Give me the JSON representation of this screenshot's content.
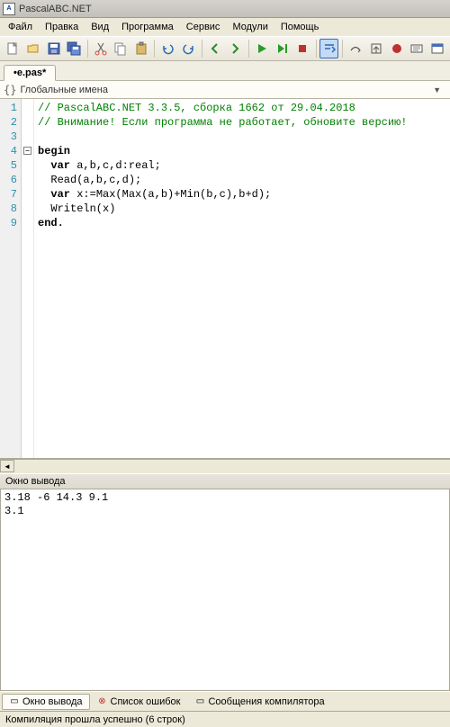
{
  "window": {
    "title": "PascalABC.NET"
  },
  "menu": {
    "items": [
      "Файл",
      "Правка",
      "Вид",
      "Программа",
      "Сервис",
      "Модули",
      "Помощь"
    ]
  },
  "tab": {
    "label": "•e.pas*"
  },
  "names_row": {
    "label": "Глобальные имена"
  },
  "code": {
    "lines": [
      "1",
      "2",
      "3",
      "4",
      "5",
      "6",
      "7",
      "8",
      "9"
    ],
    "l1": "// PascalABC.NET 3.3.5, сборка 1662 от 29.04.2018",
    "l2": "// Внимание! Если программа не работает, обновите версию!",
    "l4_begin": "begin",
    "l5_kw": "var",
    "l5_rest": " a,b,c,d:real;",
    "l6": "  Read(a,b,c,d);",
    "l7_kw": "var",
    "l7_rest": " x:=Max(Max(a,b)+Min(b,c),b+d);",
    "l8": "  Writeln(x)",
    "l9_end": "end."
  },
  "output": {
    "title": "Окно вывода",
    "line1": "3.18 -6 14.3 9.1",
    "line2": "3.1"
  },
  "bottom_tabs": {
    "t1": "Окно вывода",
    "t2": "Список ошибок",
    "t3": "Сообщения компилятора"
  },
  "status": {
    "text": "Компиляция прошла успешно (6 строк)"
  }
}
